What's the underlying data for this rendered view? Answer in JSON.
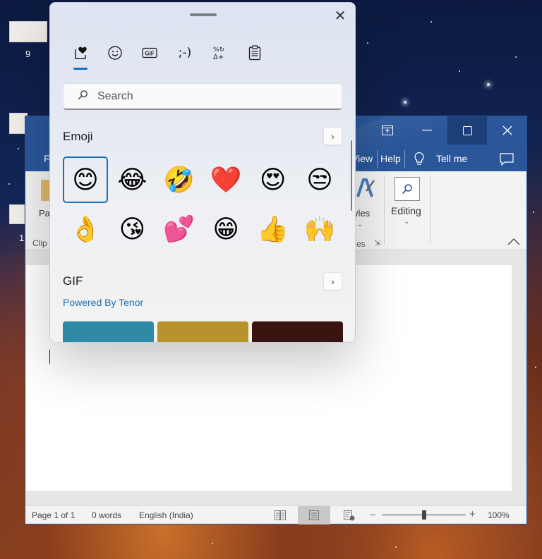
{
  "desktop": {
    "icons": [
      {
        "label": "9"
      },
      {
        "label": ""
      },
      {
        "label": "1"
      }
    ]
  },
  "word": {
    "window_controls": {
      "ribbon_display": "ribbon-display-icon",
      "minimize": "–",
      "maximize": "☐",
      "close": "✕"
    },
    "tabs": {
      "file_partial": "F",
      "view_partial": "View",
      "help": "Help",
      "tell_me": "Tell me"
    },
    "ribbon": {
      "paste_partial": "Pa",
      "clipboard_partial": "Clip",
      "styles_partial": "yles",
      "styles_group_partial": "es",
      "editing": "Editing"
    },
    "status": {
      "page": "Page 1 of 1",
      "words": "0 words",
      "language": "English (India)",
      "zoom_minus": "−",
      "zoom_plus": "+",
      "zoom": "100%",
      "zoom_level_percent": 100
    }
  },
  "emoji_panel": {
    "close": "✕",
    "categories": [
      {
        "name": "Most used",
        "icon": "heart-box-icon",
        "selected": true
      },
      {
        "name": "Emoji",
        "icon": "smiley-icon"
      },
      {
        "name": "GIF",
        "icon": "gif-icon",
        "label": "GIF"
      },
      {
        "name": "Kaomoji",
        "icon": "kaomoji-icon",
        "label": ";-)"
      },
      {
        "name": "Symbols",
        "icon": "symbols-icon",
        "label": "%↻\nΔ+"
      },
      {
        "name": "Clipboard history",
        "icon": "clipboard-icon"
      }
    ],
    "search": {
      "placeholder": "Search",
      "value": ""
    },
    "emoji_section": {
      "title": "Emoji",
      "more": "›",
      "items": [
        {
          "char": "😊",
          "name": "smiling-face-with-smiling-eyes",
          "selected": true
        },
        {
          "char": "😂",
          "name": "face-with-tears-of-joy"
        },
        {
          "char": "🤣",
          "name": "rolling-on-the-floor-laughing"
        },
        {
          "char": "❤️",
          "name": "red-heart"
        },
        {
          "char": "😍",
          "name": "smiling-face-with-heart-eyes"
        },
        {
          "char": "😒",
          "name": "unamused-face"
        },
        {
          "char": "👌",
          "name": "ok-hand"
        },
        {
          "char": "😘",
          "name": "face-blowing-a-kiss"
        },
        {
          "char": "💕",
          "name": "two-hearts"
        },
        {
          "char": "😁",
          "name": "beaming-face-with-smiling-eyes"
        },
        {
          "char": "👍",
          "name": "thumbs-up"
        },
        {
          "char": "🙌",
          "name": "raising-hands"
        }
      ]
    },
    "gif_section": {
      "title": "GIF",
      "more": "›",
      "powered_by": "Powered By Tenor",
      "thumbnails": [
        {
          "color": "#2f8aa8"
        },
        {
          "color": "#b8922c"
        },
        {
          "color": "#3a1410"
        }
      ]
    }
  }
}
